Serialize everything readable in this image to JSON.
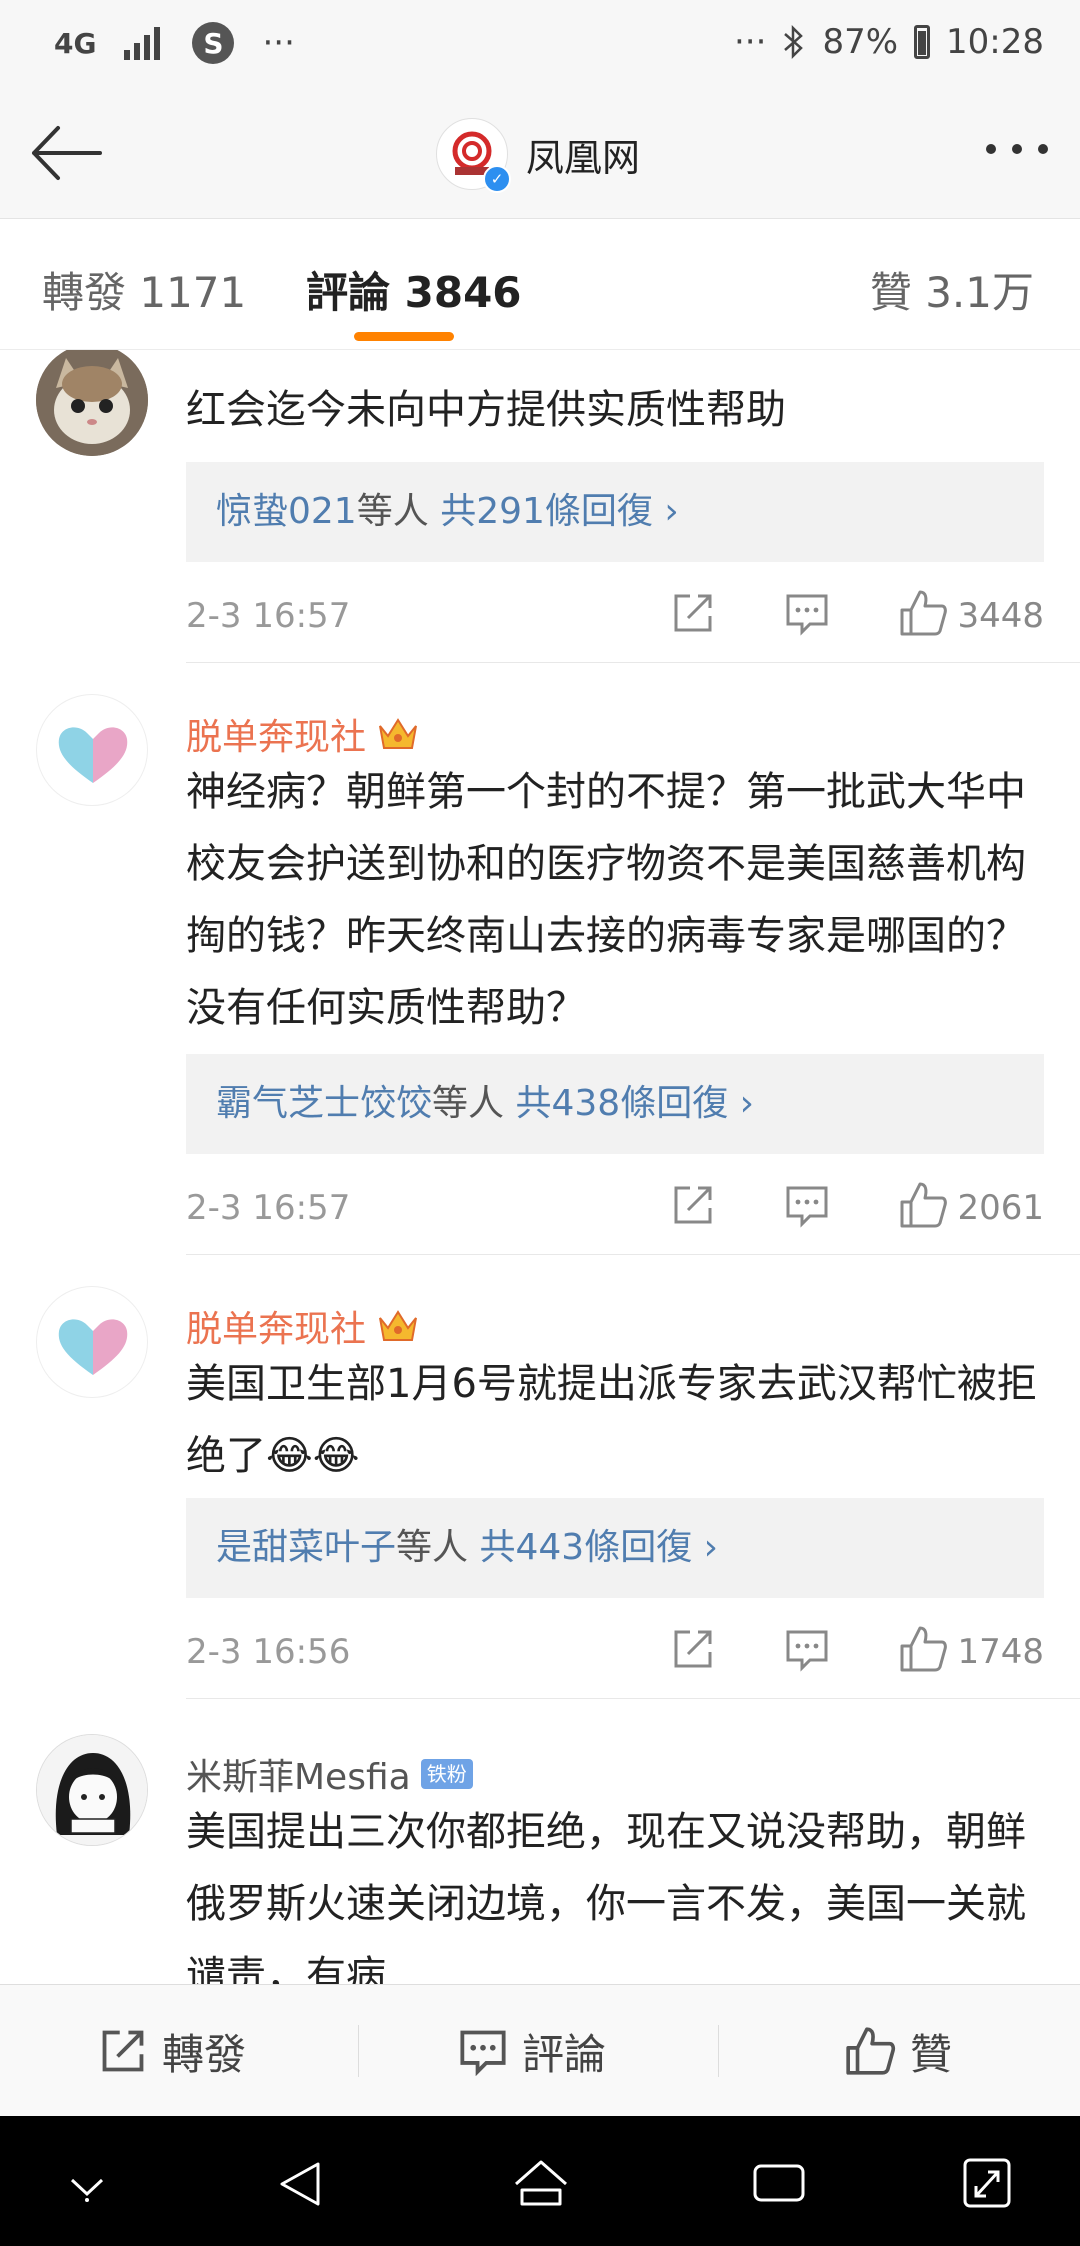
{
  "status_bar": {
    "network": "4G",
    "s_badge": "S",
    "left_dots": "···",
    "right_dots": "···",
    "battery": "87%",
    "time": "10:28"
  },
  "nav": {
    "title": "凤凰网"
  },
  "tabs": [
    {
      "label": "轉發 1171"
    },
    {
      "label": "評論 3846"
    },
    {
      "label": "贊 3.1万"
    }
  ],
  "comments": [
    {
      "author": "",
      "text": "红会迄今未向中方提供实质性帮助",
      "reply_user": "惊蛰021",
      "reply_mid": "等人",
      "reply_count": "共291條回復",
      "chevron": "›",
      "time": "2-3 16:57",
      "likes": "3448"
    },
    {
      "author": "脱单奔现社",
      "text": "神经病？朝鲜第一个封的不提？第一批武大华中校友会护送到协和的医疗物资不是美国慈善机构掏的钱？昨天终南山去接的病毒专家是哪国的？没有任何实质性帮助？",
      "reply_user": "霸气芝士饺饺",
      "reply_mid": "等人",
      "reply_count": "共438條回復",
      "chevron": "›",
      "time": "2-3 16:57",
      "likes": "2061"
    },
    {
      "author": "脱单奔现社",
      "text": "美国卫生部1月6号就提出派专家去武汉帮忙被拒绝了😂😂",
      "reply_user": "是甜菜叶子",
      "reply_mid": "等人",
      "reply_count": "共443條回復",
      "chevron": "›",
      "time": "2-3 16:56",
      "likes": "1748"
    },
    {
      "author": "米斯菲Mesfia",
      "badge": "铁粉",
      "text": "美国提出三次你都拒绝，现在又说没帮助，朝鲜俄罗斯火速关闭边境，你一言不发，美国一关就谴责，有病"
    }
  ],
  "bottom_bar": {
    "repost": "轉發",
    "comment": "評論",
    "like": "贊"
  },
  "colors": {
    "accent": "#ff8200",
    "vip_name": "#eb7350",
    "link_blue": "#507daf"
  }
}
